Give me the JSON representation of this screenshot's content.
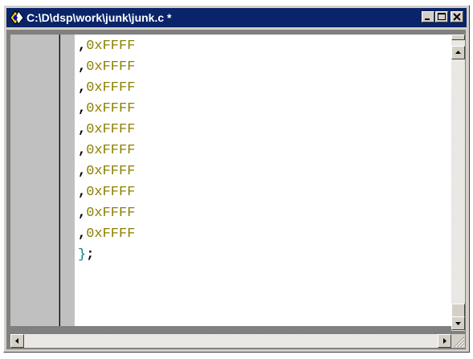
{
  "window": {
    "title": "C:\\D\\dsp\\work\\junk\\junk.c *",
    "icon": "editor-app-icon",
    "controls": [
      "minimize-icon",
      "maximize-icon",
      "close-icon"
    ]
  },
  "editor": {
    "lines": [
      {
        "comma": ",",
        "value": "0xFFFF"
      },
      {
        "comma": ",",
        "value": "0xFFFF"
      },
      {
        "comma": ",",
        "value": "0xFFFF"
      },
      {
        "comma": ",",
        "value": "0xFFFF"
      },
      {
        "comma": ",",
        "value": "0xFFFF"
      },
      {
        "comma": ",",
        "value": "0xFFFF"
      },
      {
        "comma": ",",
        "value": "0xFFFF"
      },
      {
        "comma": ",",
        "value": "0xFFFF"
      },
      {
        "comma": ",",
        "value": "0xFFFF"
      },
      {
        "comma": ",",
        "value": "0xFFFF"
      }
    ],
    "closing": {
      "brace": "}",
      "semicolon": ";"
    }
  },
  "colors": {
    "titlebar": "#0a246a",
    "hex_literal": "#8b8000",
    "brace": "#008080"
  }
}
